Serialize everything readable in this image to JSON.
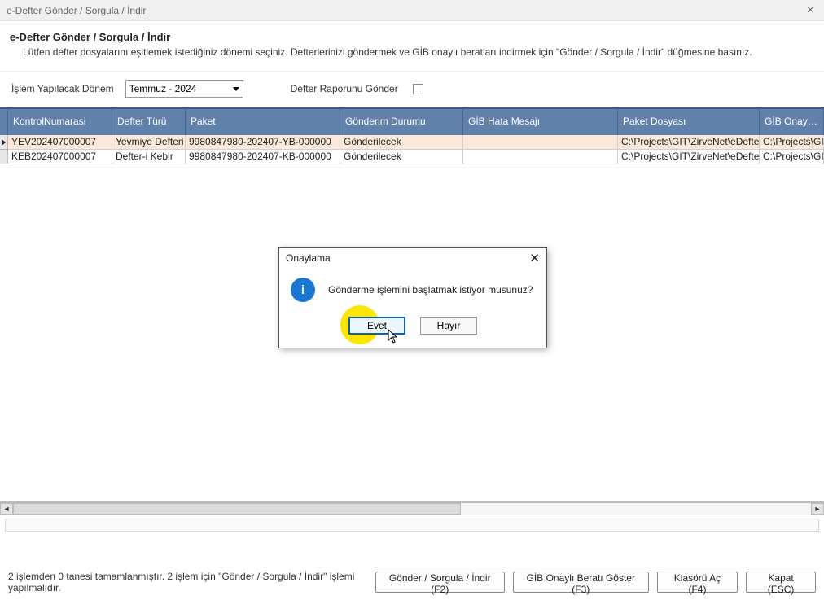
{
  "window": {
    "title": "e-Defter Gönder / Sorgula / İndir",
    "close_icon": "×"
  },
  "header": {
    "title": "e-Defter Gönder / Sorgula / İndir",
    "subtitle": "Lütfen defter dosyalarını eşitlemek istediğiniz dönemi seçiniz. Defterlerinizi göndermek ve GİB onaylı beratları indirmek için \"Gönder / Sorgula / İndir\" düğmesine basınız."
  },
  "controls": {
    "period_label": "İşlem Yapılacak Dönem",
    "period_value": "Temmuz - 2024",
    "report_label": "Defter Raporunu Gönder"
  },
  "grid": {
    "columns": {
      "kontrol": "KontrolNumarasi",
      "defter": "Defter Türü",
      "paket": "Paket",
      "gonderim": "Gönderim Durumu",
      "hata": "GİB Hata Mesajı",
      "dosya": "Paket Dosyası",
      "onay": "GİB Onaylı Pa"
    },
    "rows": [
      {
        "kontrol": "YEV202407000007",
        "defter": "Yevmiye Defteri",
        "paket": "9980847980-202407-YB-000000",
        "gonderim": "Gönderilecek",
        "hata": "",
        "dosya": "C:\\Projects\\GIT\\ZirveNet\\eDefter\\Z",
        "onay": "C:\\Projects\\GIT"
      },
      {
        "kontrol": "KEB202407000007",
        "defter": "Defter-i Kebir",
        "paket": "9980847980-202407-KB-000000",
        "gonderim": "Gönderilecek",
        "hata": "",
        "dosya": "C:\\Projects\\GIT\\ZirveNet\\eDefter\\Z",
        "onay": "C:\\Projects\\GIT"
      }
    ]
  },
  "dialog": {
    "title": "Onaylama",
    "message": "Gönderme işlemini başlatmak istiyor musunuz?",
    "yes": "Evet",
    "no": "Hayır",
    "close": "✕"
  },
  "footer": {
    "status": "2 işlemden 0 tanesi tamamlanmıştır. 2 işlem için \"Gönder / Sorgula / İndir\" işlemi yapılmalıdır.",
    "buttons": {
      "gonder": "Gönder / Sorgula / İndir (F2)",
      "berat": "GİB Onaylı Beratı Göster (F3)",
      "klasor": "Klasörü Aç (F4)",
      "kapat": "Kapat (ESC)"
    }
  },
  "scroll": {
    "left": "◄",
    "right": "►"
  }
}
